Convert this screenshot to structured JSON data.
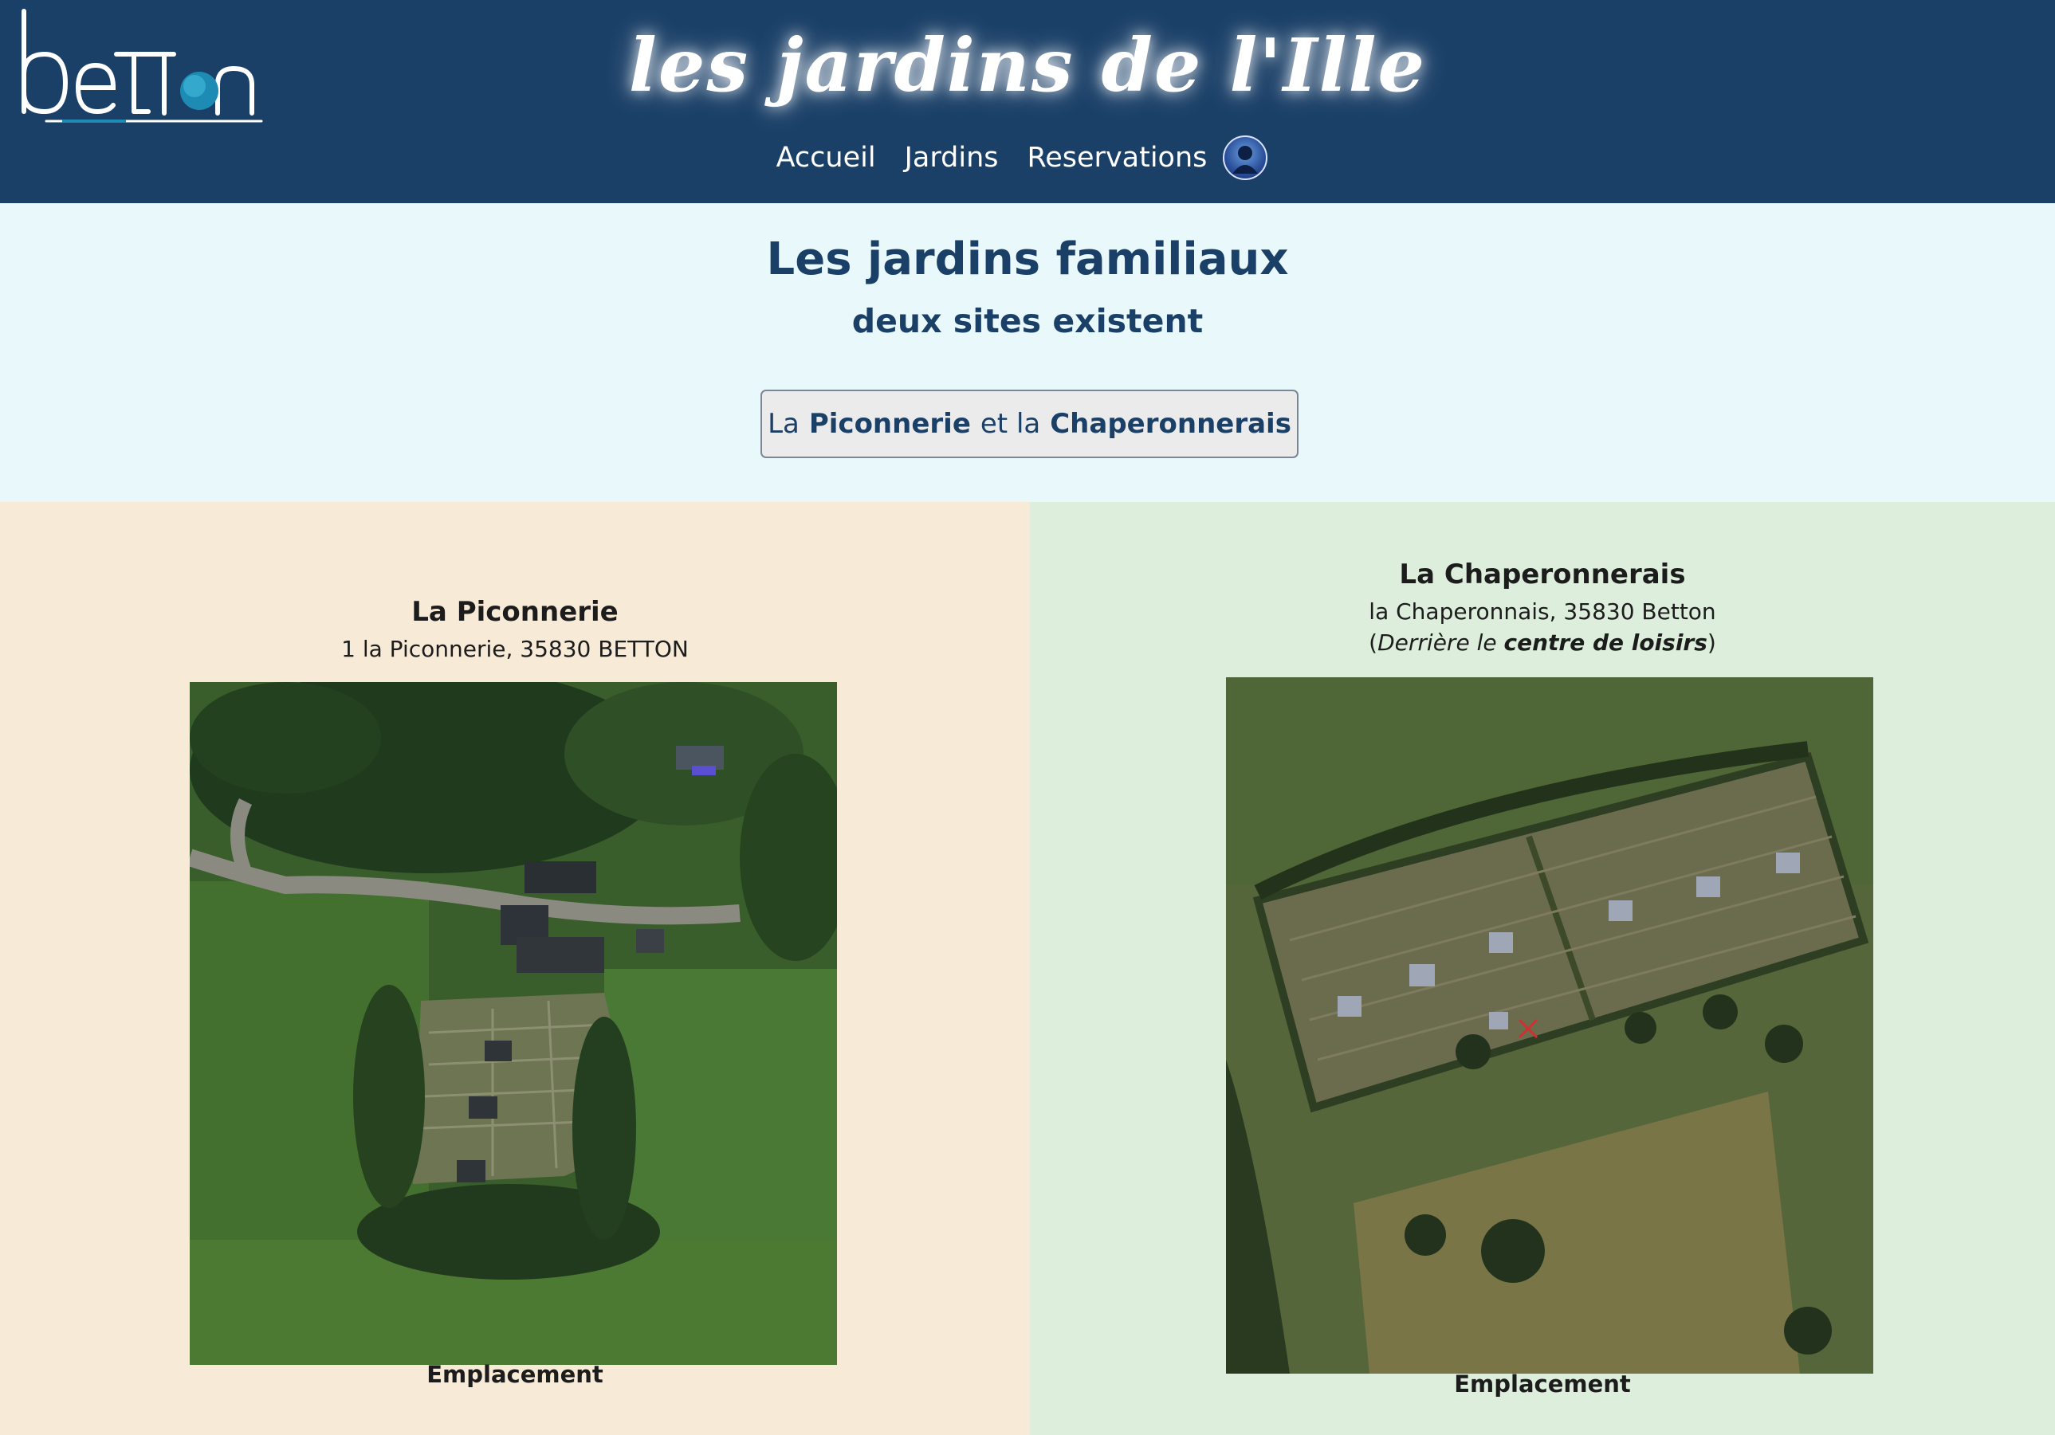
{
  "header": {
    "logo_text": "betton",
    "site_title": "les jardins de l'Ille",
    "nav": {
      "home": "Accueil",
      "gardens": "Jardins",
      "reservations": "Reservations"
    },
    "user_icon": "user-avatar-icon"
  },
  "intro": {
    "title": "Les jardins familiaux",
    "subtitle": "deux sites existent",
    "button": {
      "prefix": "La",
      "site1": "Piconnerie",
      "middle": "et la",
      "site2": "Chaperonnerais"
    }
  },
  "sites": [
    {
      "name": "La Piconnerie",
      "address": "1 la Piconnerie, 35830 BETTON",
      "location_label": "Emplacement"
    },
    {
      "name": "La Chaperonnerais",
      "address": "la Chaperonnais, 35830 Betton",
      "note_open": "(",
      "note_italic": "Derrière le",
      "note_bold": "centre de loisirs",
      "note_close": ")",
      "location_label": "Emplacement"
    }
  ],
  "colors": {
    "header_bg": "#1b4068",
    "intro_bg": "#e8f8fb",
    "panel_left_bg": "#f7ead7",
    "panel_right_bg": "#ddefdc",
    "accent_text": "#1b4068"
  }
}
